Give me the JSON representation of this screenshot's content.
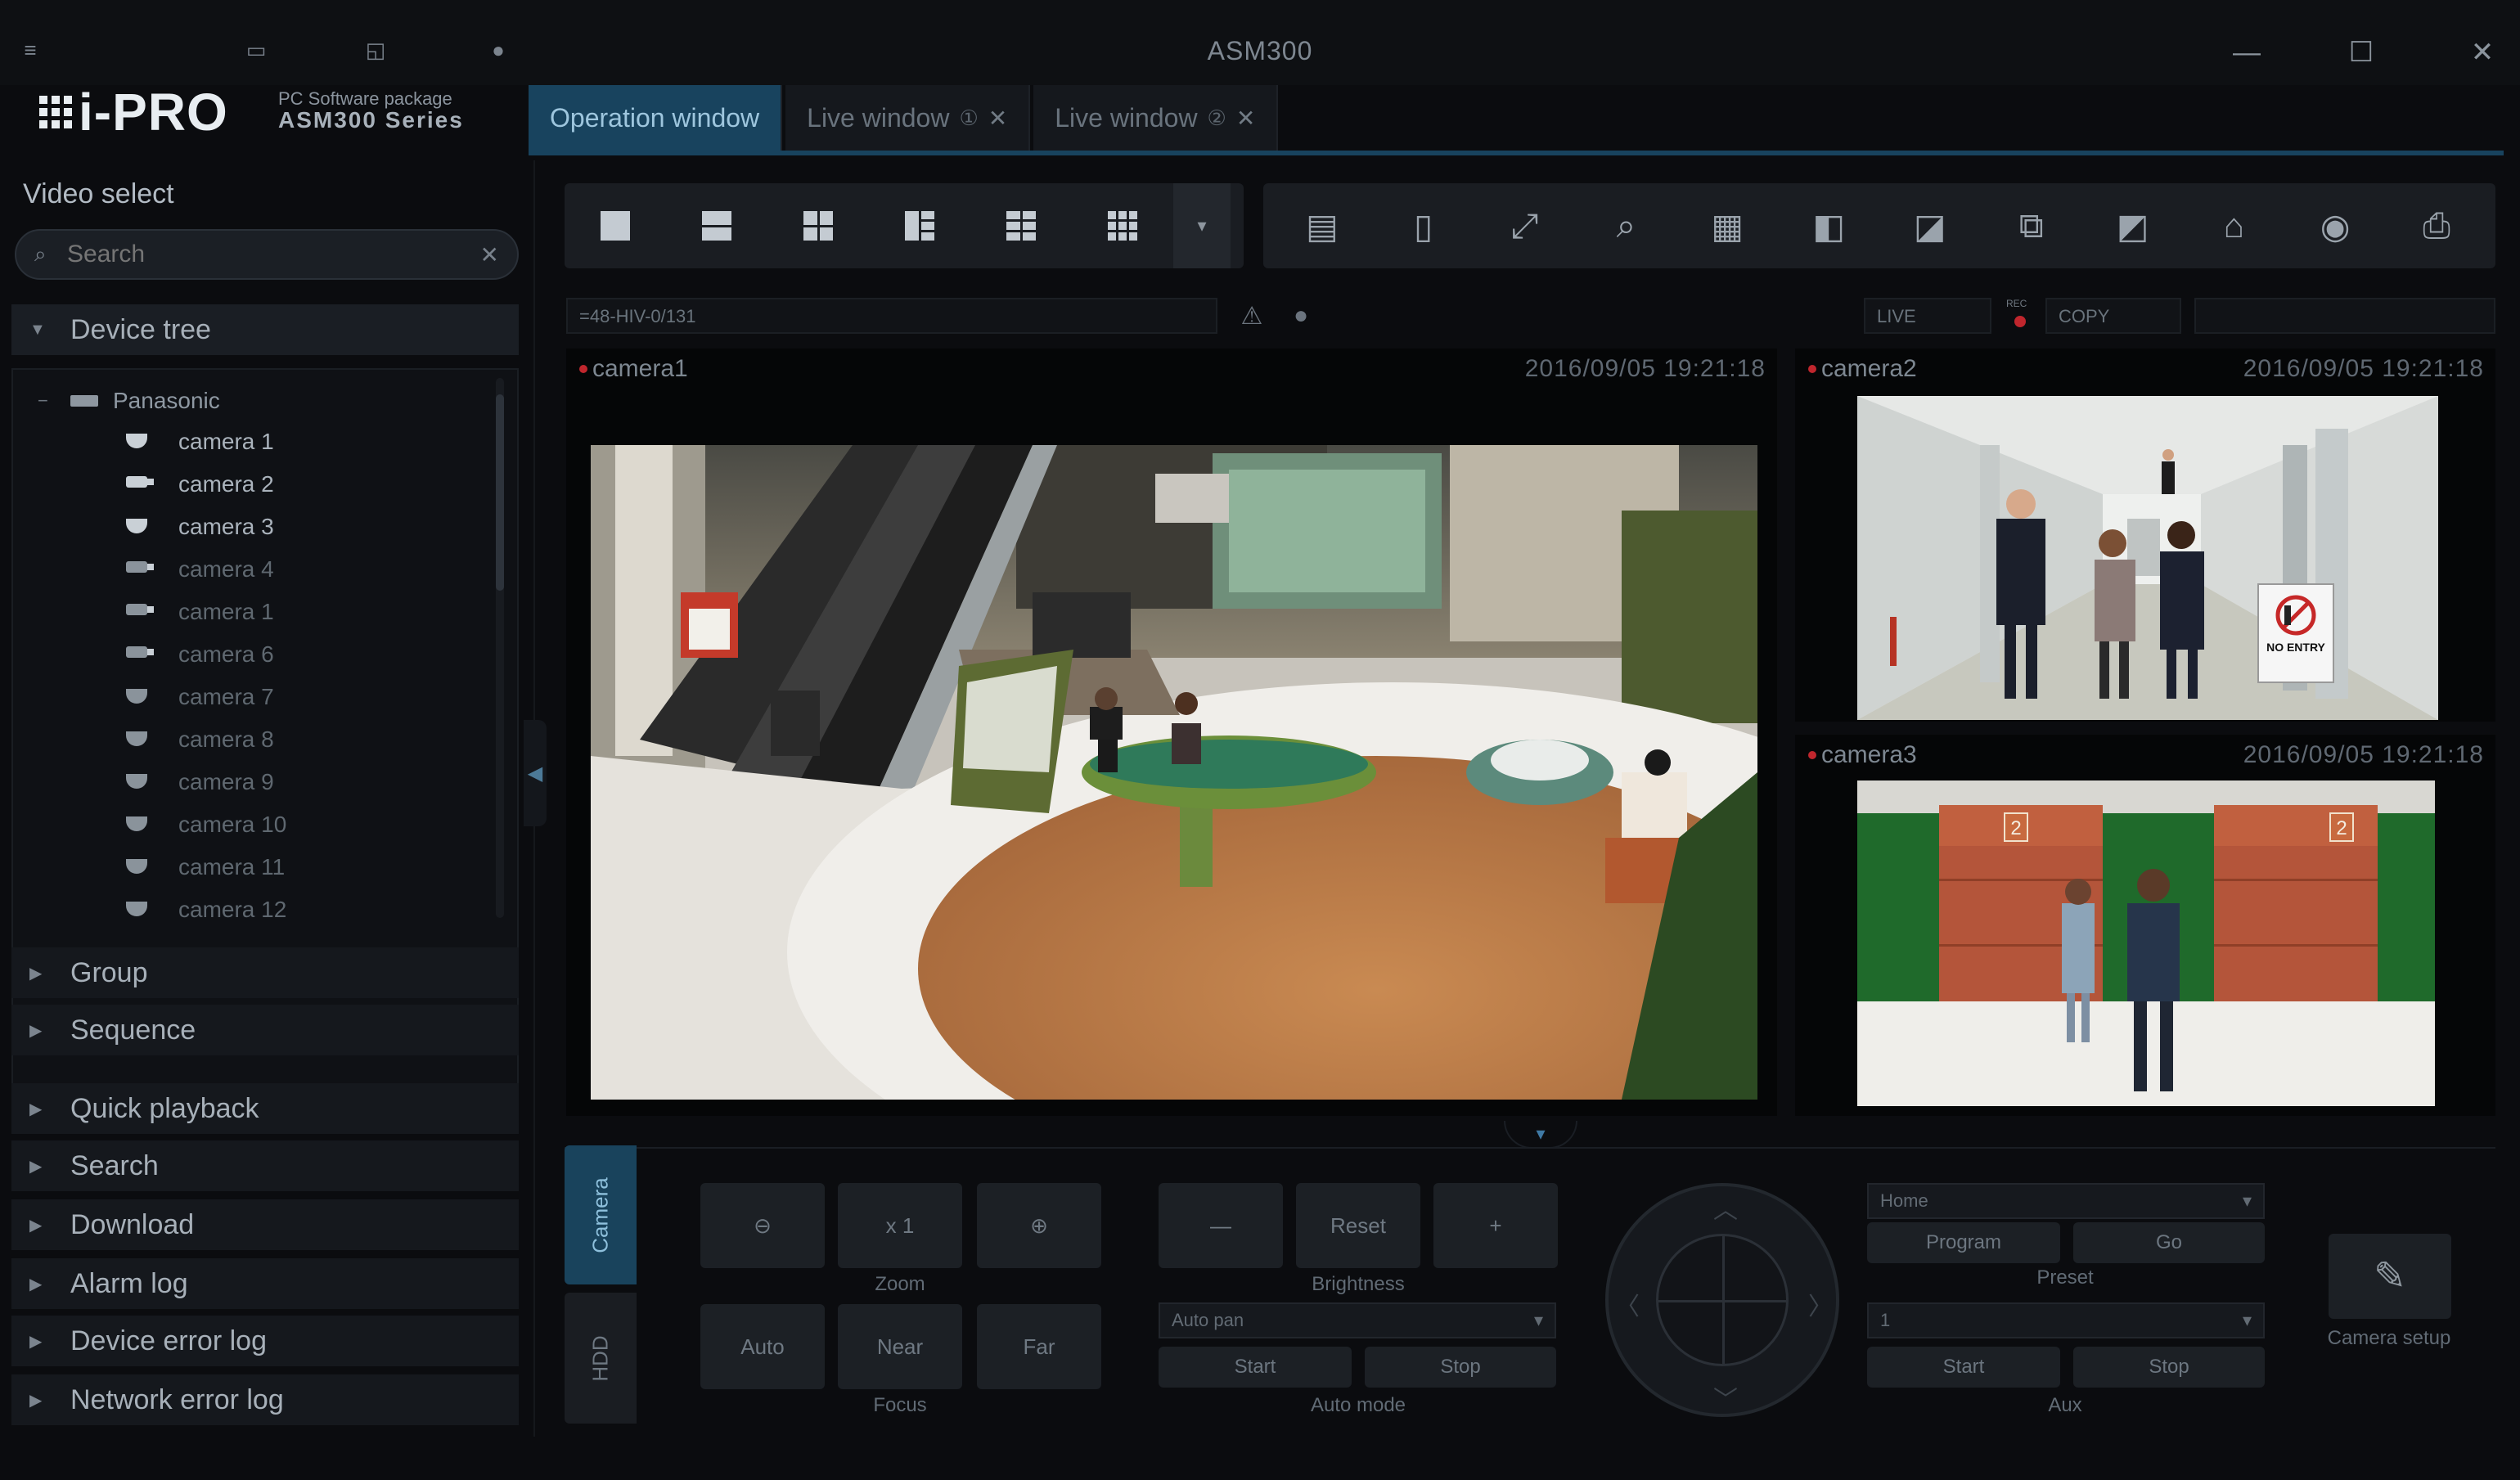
{
  "app": {
    "title": "ASM300",
    "brand": "i-PRO",
    "package_line": "PC Software package",
    "series": "ASM300 Series"
  },
  "tabs": [
    {
      "label": "Operation window",
      "active": true
    },
    {
      "label": "Live window",
      "num": "①",
      "close": "✕"
    },
    {
      "label": "Live window",
      "num": "②",
      "close": "✕"
    }
  ],
  "left": {
    "video_select": "Video select",
    "search_placeholder": "Search",
    "device_tree": "Device tree",
    "root": "Panasonic",
    "cameras": [
      "camera 1",
      "camera 2",
      "camera 3",
      "camera 4",
      "camera 1",
      "camera 6",
      "camera 7",
      "camera 8",
      "camera 9",
      "camera 10",
      "camera 11",
      "camera 12"
    ],
    "sections_top": [
      "Group",
      "Sequence"
    ],
    "sections_bottom": [
      "Quick playback",
      "Search",
      "Download",
      "Alarm log",
      "Device error log",
      "Network error log"
    ]
  },
  "status": {
    "device": "=48-HIV-0/131",
    "live": "LIVE",
    "rec": "REC",
    "copy": "COPY"
  },
  "panes": [
    {
      "name": "camera1",
      "time": "2016/09/05 19:21:18"
    },
    {
      "name": "camera2",
      "time": "2016/09/05 19:21:18"
    },
    {
      "name": "camera3",
      "time": "2016/09/05 19:21:18"
    }
  ],
  "scene": {
    "no_entry": "NO ENTRY",
    "floor_number": "2"
  },
  "control": {
    "tab_camera": "Camera",
    "tab_hdd": "HDD",
    "zoom_x1": "x 1",
    "zoom_label": "Zoom",
    "focus_auto": "Auto",
    "focus_near": "Near",
    "focus_far": "Far",
    "focus_label": "Focus",
    "brightness_minus": "—",
    "brightness_reset": "Reset",
    "brightness_plus": "+",
    "brightness_label": "Brightness",
    "auto_mode_select": "Auto pan",
    "auto_start": "Start",
    "auto_stop": "Stop",
    "auto_mode_label": "Auto mode",
    "preset_select": "Home",
    "preset_program": "Program",
    "preset_go": "Go",
    "preset_label": "Preset",
    "aux_select": "1",
    "aux_start": "Start",
    "aux_stop": "Stop",
    "aux_label": "Aux",
    "camera_setup": "Camera setup"
  }
}
